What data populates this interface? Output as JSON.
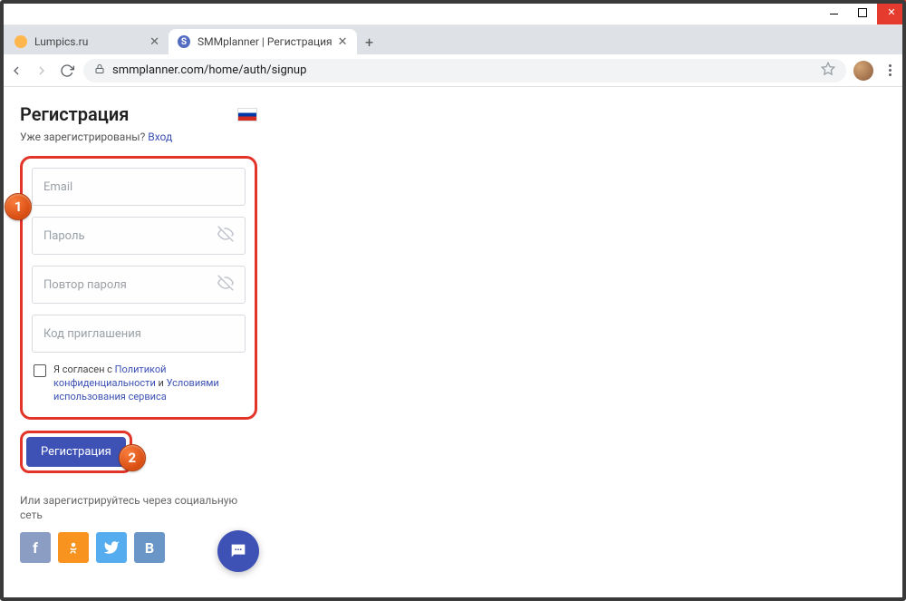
{
  "window": {
    "tabs": [
      {
        "title": "Lumpics.ru",
        "favicon": "lump",
        "active": false
      },
      {
        "title": "SMMplanner | Регистрация",
        "favicon": "smm",
        "active": true
      }
    ],
    "url": "smmplanner.com/home/auth/signup"
  },
  "page": {
    "title": "Регистрация",
    "already_text": "Уже зарегистрированы? ",
    "login_link": "Вход",
    "fields": {
      "email_placeholder": "Email",
      "password_placeholder": "Пароль",
      "password_repeat_placeholder": "Повтор пароля",
      "invite_placeholder": "Код приглашения"
    },
    "consent": {
      "prefix": "Я согласен с ",
      "privacy": "Политикой конфиденциальности",
      "and": " и ",
      "terms": "Условиями использования сервиса"
    },
    "submit_label": "Регистрация",
    "social_text": "Или зарегистрируйтесь через социальную сеть",
    "social": {
      "fb": "f",
      "ok": "OK",
      "tw": "",
      "vk": "B"
    }
  },
  "annotations": {
    "badge1": "1",
    "badge2": "2"
  }
}
